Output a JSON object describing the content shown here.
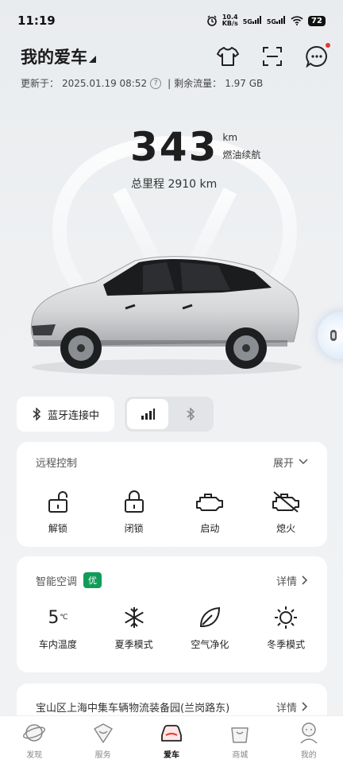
{
  "status": {
    "time": "11:19",
    "net_speed": "10.4",
    "net_unit": "KB/s",
    "signal1": "5G",
    "signal2": "5G",
    "battery": "72"
  },
  "header": {
    "title": "我的爱车"
  },
  "update": {
    "updated_prefix": "更新于：",
    "updated_time": "2025.01.19 08:52",
    "separator": "|",
    "data_label": "剩余流量：",
    "data_value": "1.97 GB"
  },
  "range": {
    "value": "343",
    "unit": "km",
    "label": "燃油续航",
    "odometer": "总里程 2910 km"
  },
  "connection": {
    "bt_label": "蓝牙连接中"
  },
  "remote": {
    "title": "远程控制",
    "expand": "展开",
    "items": [
      {
        "label": "解锁",
        "icon": "unlock-icon"
      },
      {
        "label": "闭锁",
        "icon": "lock-icon"
      },
      {
        "label": "启动",
        "icon": "engine-start-icon"
      },
      {
        "label": "熄火",
        "icon": "engine-off-icon"
      }
    ]
  },
  "ac": {
    "title": "智能空调",
    "badge": "优",
    "details": "详情",
    "temp_value": "5",
    "temp_unit": "℃",
    "items": [
      {
        "label": "车内温度"
      },
      {
        "label": "夏季模式",
        "icon": "snowflake-icon"
      },
      {
        "label": "空气净化",
        "icon": "leaf-icon"
      },
      {
        "label": "冬季模式",
        "icon": "sun-icon"
      }
    ]
  },
  "location": {
    "address": "宝山区上海中集车辆物流装备园(兰岗路东)",
    "details": "详情"
  },
  "tabs": [
    {
      "label": "发现",
      "active": false
    },
    {
      "label": "服务",
      "active": false
    },
    {
      "label": "爱车",
      "active": true
    },
    {
      "label": "商城",
      "active": false
    },
    {
      "label": "我的",
      "active": false
    }
  ],
  "colors": {
    "accent_green": "#0f9d58",
    "active_tab_red": "#e53935"
  }
}
